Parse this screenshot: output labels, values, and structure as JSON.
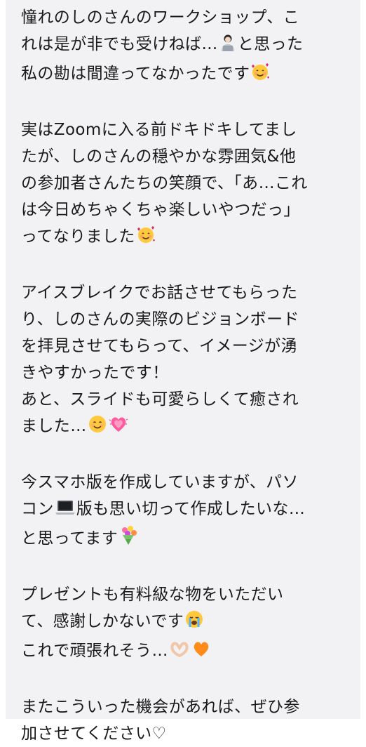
{
  "message": {
    "p1": {
      "l1": "憧れのしのさんのワークショップ、こ",
      "l2a": "れは是が非でも受けねば…",
      "l2b": "と思った",
      "l3": "私の勘は間違ってなかったです"
    },
    "p2": {
      "l1": "実はZoomに入る前ドキドキしてまし",
      "l2": "たが、しのさんの穏やかな雰囲気&他",
      "l3": "の参加者さんたちの笑顔で、「あ…これ",
      "l4": "は今日めちゃくちゃ楽しいやつだっ」",
      "l5": "ってなりました"
    },
    "p3": {
      "l1": "アイスブレイクでお話させてもらった",
      "l2": "り、しのさんの実際のビジョンボード",
      "l3": "を拝見させてもらって、イメージが湧",
      "l4": "きやすかったです！",
      "l5": "あと、スライドも可愛らしくて癒され",
      "l6": "ました…"
    },
    "p4": {
      "l1": "今スマホ版を作成していますが、パソ",
      "l2a": "コン",
      "l2b": "版も思い切って作成したいな…",
      "l3": "と思ってます"
    },
    "p5": {
      "l1": "プレゼントも有料級な物をいただい",
      "l2": "て、感謝しかないです",
      "l3": "これで頑張れそう…"
    },
    "p6": {
      "l1": "またこういった機会があれば、ぜひ参",
      "l2": "加させてください♡"
    }
  },
  "icons": {
    "person_laptop": "person-with-laptop-icon",
    "smiling_hearts": "smiling-face-with-hearts-icon",
    "smiling_face": "smiling-face-icon",
    "growing_heart": "growing-heart-icon",
    "laptop": "laptop-icon",
    "bouquet": "bouquet-icon",
    "crying_face": "crying-face-icon",
    "heart_hands": "heart-hands-icon",
    "orange_heart": "orange-heart-icon"
  },
  "colors": {
    "bubble_bg": "#f2f2f4",
    "text": "#1a1a1a",
    "background": "#ffffff"
  }
}
